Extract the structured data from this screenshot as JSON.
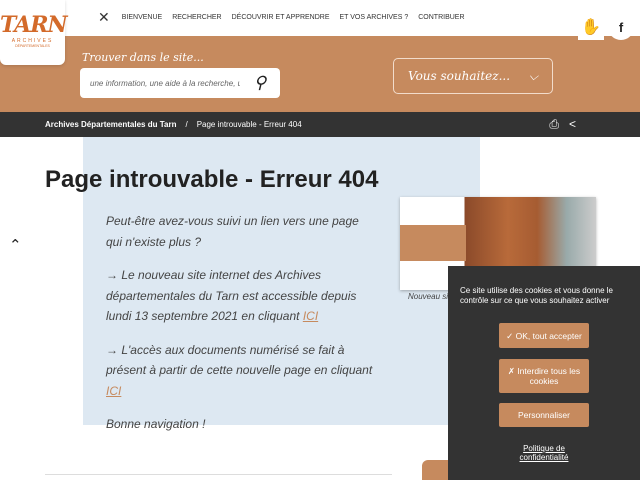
{
  "logo": {
    "name": "TARN",
    "sub1": "ARCHIVES",
    "sub2": "DÉPARTEMENTALES"
  },
  "nav": {
    "close": "✕",
    "items": [
      "BIENVENUE",
      "RECHERCHER",
      "DÉCOUVRIR ET APPRENDRE",
      "ET VOS ARCHIVES ?",
      "CONTRIBUER"
    ]
  },
  "social": {
    "sign_language": "✋",
    "facebook": "f"
  },
  "search": {
    "label": "Trouver dans le site...",
    "placeholder": "une information, une aide à la recherche, un c",
    "icon": "⚲"
  },
  "vous": {
    "label": "Vous souhaitez...",
    "icon": "⌵"
  },
  "breadcrumb": {
    "home": "Archives Départementales du Tarn",
    "sep": "/",
    "current": "Page introuvable - Erreur 404"
  },
  "tools": {
    "print": "⎙",
    "share": "<"
  },
  "page": {
    "title": "Page introuvable - Erreur 404",
    "p1": "Peut-être avez-vous suivi un lien vers une page qui n'existe plus ?",
    "p2": "→ Le nouveau site internet des Archives départementales du Tarn est accessible depuis lundi 13 septembre 2021 en cliquant ",
    "p2_link": "ICI",
    "p3": "→ L'accès aux documents numérisé se fait à présent à partir de cette nouvelle page en cliquant ",
    "p3_link": "ICI",
    "p4": "Bonne navigation !",
    "caption": "Nouveau site"
  },
  "scroll_up": "⌃",
  "cookie": {
    "message": "Ce site utilise des cookies et vous donne le contrôle sur ce que vous souhaitez activer",
    "accept": "✓ OK, tout accepter",
    "deny": "✗ Interdire tous les cookies",
    "customize": "Personnaliser",
    "policy": "Politique de confidentialité"
  },
  "colors": {
    "brand": "#c68a5e",
    "dark": "#333333",
    "panel": "#dde8f2"
  }
}
